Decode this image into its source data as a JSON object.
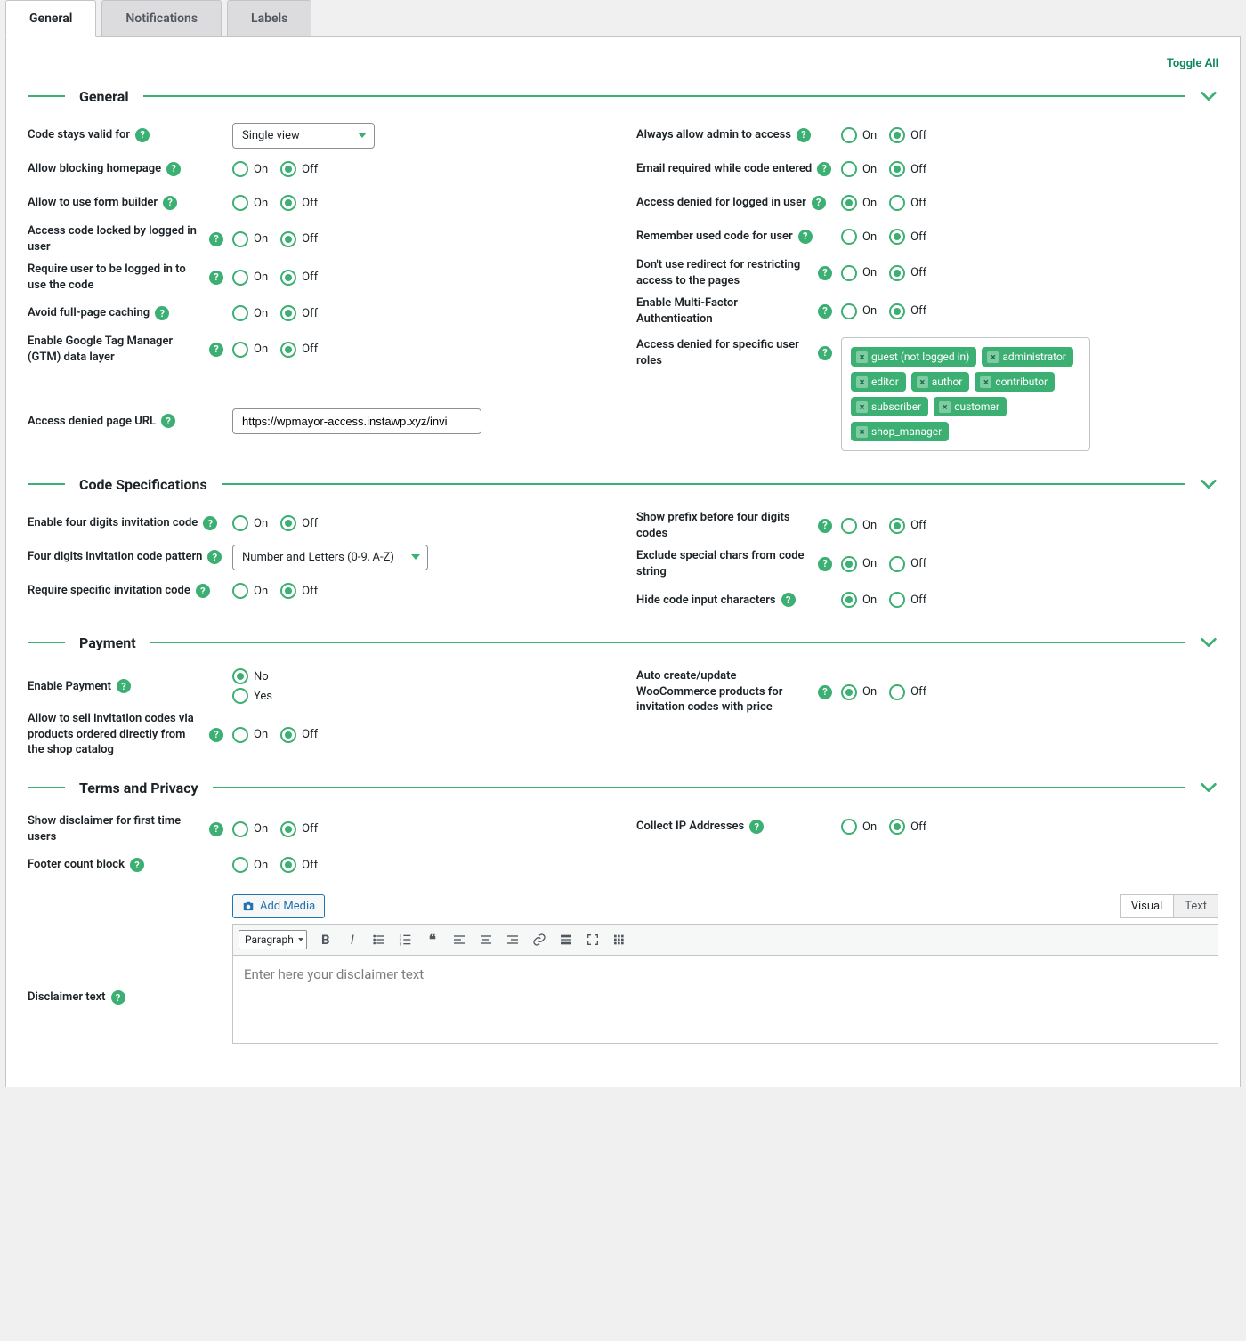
{
  "tabs": {
    "general": "General",
    "notifications": "Notifications",
    "labels": "Labels"
  },
  "toggle_all": "Toggle All",
  "text": {
    "on": "On",
    "off": "Off",
    "help": "?",
    "yes": "Yes",
    "no": "No"
  },
  "sections": {
    "general": {
      "title": "General"
    },
    "codespec": {
      "title": "Code Specifications"
    },
    "payment": {
      "title": "Payment"
    },
    "terms": {
      "title": "Terms and Privacy"
    }
  },
  "general": {
    "code_stays_valid_for": {
      "label": "Code stays valid for",
      "value": "Single view"
    },
    "allow_blocking_homepage": {
      "label": "Allow blocking homepage",
      "value": "off"
    },
    "allow_form_builder": {
      "label": "Allow to use form builder",
      "value": "off"
    },
    "code_locked_by_user": {
      "label": "Access code locked by logged in user",
      "value": "off"
    },
    "require_logged_in": {
      "label": "Require user to be logged in to use the code",
      "value": "off"
    },
    "avoid_caching": {
      "label": "Avoid full-page caching",
      "value": "off"
    },
    "gtm": {
      "label": "Enable Google Tag Manager (GTM) data layer",
      "value": "off"
    },
    "denied_url": {
      "label": "Access denied page URL",
      "value": "https://wpmayor-access.instawp.xyz/invi"
    },
    "always_allow_admin": {
      "label": "Always allow admin to access",
      "value": "off"
    },
    "email_required": {
      "label": "Email required while code entered",
      "value": "off"
    },
    "denied_logged_in": {
      "label": "Access denied for logged in user",
      "value": "on"
    },
    "remember_code": {
      "label": "Remember used code for user",
      "value": "off"
    },
    "no_redirect": {
      "label": "Don't use redirect for restricting access to the pages",
      "value": "off"
    },
    "mfa": {
      "label": "Enable Multi-Factor Authentication",
      "value": "off"
    },
    "denied_roles": {
      "label": "Access denied for specific user roles",
      "tags": [
        "guest (not logged in)",
        "administrator",
        "editor",
        "author",
        "contributor",
        "subscriber",
        "customer",
        "shop_manager"
      ]
    }
  },
  "codespec": {
    "enable_four_digits": {
      "label": "Enable four digits invitation code",
      "value": "off"
    },
    "pattern": {
      "label": "Four digits invitation code pattern",
      "value": "Number and Letters (0-9, A-Z)"
    },
    "require_specific": {
      "label": "Require specific invitation code",
      "value": "off"
    },
    "show_prefix": {
      "label": "Show prefix before four digits codes",
      "value": "off"
    },
    "exclude_special": {
      "label": "Exclude special chars from code string",
      "value": "on"
    },
    "hide_input": {
      "label": "Hide code input characters",
      "value": "on"
    }
  },
  "payment": {
    "enable": {
      "label": "Enable Payment",
      "value": "no"
    },
    "sell_via_catalog": {
      "label": "Allow to sell invitation codes via products ordered directly from the shop catalog",
      "value": "off"
    },
    "woo_products": {
      "label": "Auto create/update WooCommerce products for invitation codes with price",
      "value": "on"
    }
  },
  "terms": {
    "show_disclaimer": {
      "label": "Show disclaimer for first time users",
      "value": "off"
    },
    "footer_block": {
      "label": "Footer count block",
      "value": "off"
    },
    "collect_ip": {
      "label": "Collect IP Addresses",
      "value": "off"
    },
    "disclaimer_text": {
      "label": "Disclaimer text"
    }
  },
  "editor": {
    "add_media": "Add Media",
    "tab_visual": "Visual",
    "tab_text": "Text",
    "format_select": "Paragraph",
    "placeholder": "Enter here your disclaimer text"
  }
}
